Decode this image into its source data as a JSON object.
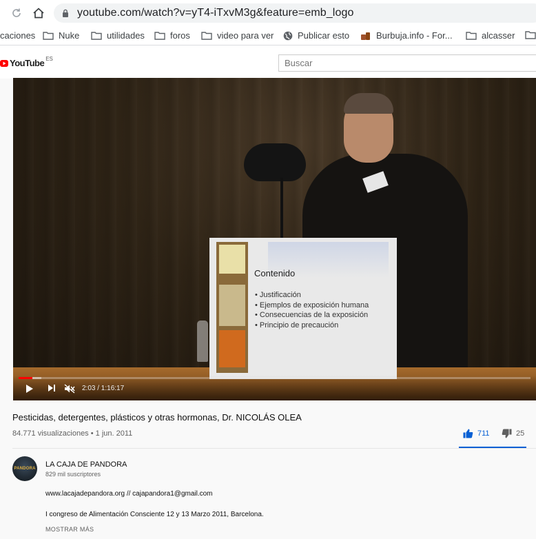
{
  "browser": {
    "url": "youtube.com/watch?v=yT4-iTxvM3g&feature=emb_logo"
  },
  "bookmarks": [
    {
      "label": "caciones",
      "icon": "none"
    },
    {
      "label": "Nuke",
      "icon": "folder-icon"
    },
    {
      "label": "utilidades",
      "icon": "folder-icon"
    },
    {
      "label": "foros",
      "icon": "folder-icon"
    },
    {
      "label": "video para ver",
      "icon": "folder-icon"
    },
    {
      "label": "Publicar esto",
      "icon": "globe-icon"
    },
    {
      "label": "Burbuja.info - For...",
      "icon": "burbuja-icon"
    },
    {
      "label": "alcasser",
      "icon": "folder-icon"
    }
  ],
  "header": {
    "logo_text": "YouTube",
    "region": "ES",
    "search_placeholder": "Buscar"
  },
  "player": {
    "time": "2:03 / 1:16:17",
    "progress_fraction": 0.027,
    "buffer_fraction": 0.045,
    "slide": {
      "title": "Contenido",
      "items": [
        "• Justificación",
        "• Ejemplos de exposición humana",
        "• Consecuencias de la exposición",
        "• Principio de precaución"
      ]
    },
    "accent": "#ff0000"
  },
  "video": {
    "title": "Pesticidas, detergentes, plásticos y otras hormonas, Dr. NICOLÁS OLEA",
    "meta": "84.771 visualizaciones • 1 jun. 2011",
    "likes": "711",
    "dislikes": "25"
  },
  "channel": {
    "name": "LA CAJA DE PANDORA",
    "subscribers": "829 mil suscriptores",
    "avatar_text": "PANDORA"
  },
  "description": {
    "line1": "www.lacajadepandora.org // cajapandora1@gmail.com",
    "line2": "I congreso de Alimentación Consciente 12 y 13 Marzo 2011, Barcelona.",
    "show_more": "MOSTRAR MÁS"
  },
  "colors": {
    "link_blue": "#065fd4",
    "yt_red": "#ff0000"
  }
}
